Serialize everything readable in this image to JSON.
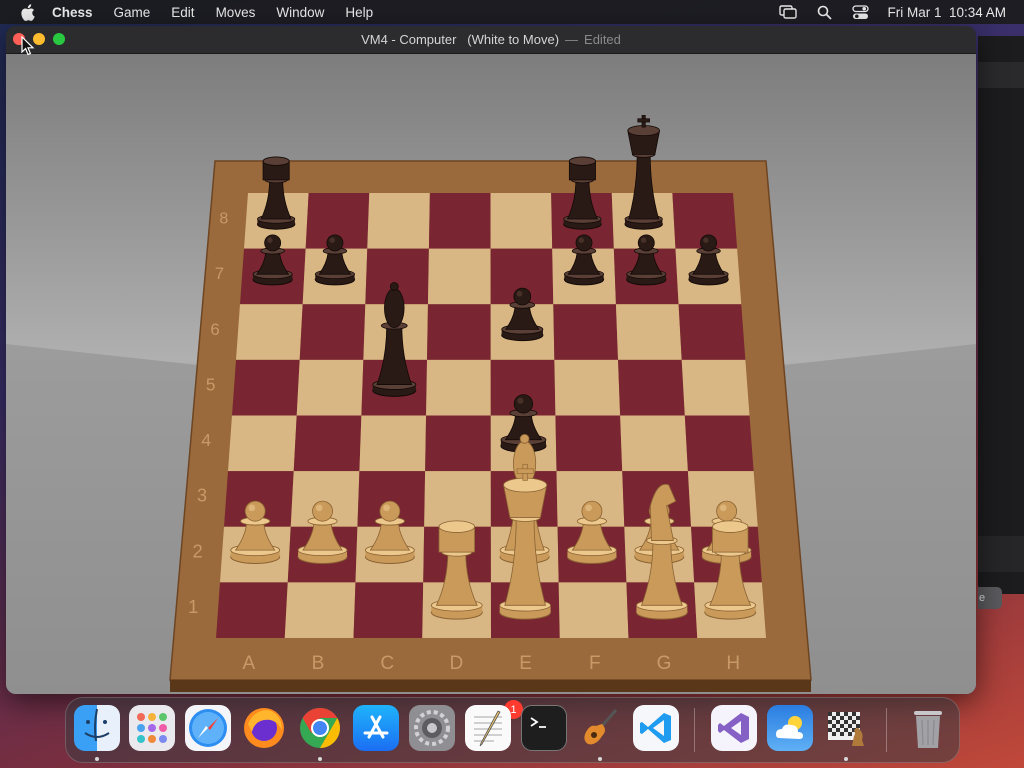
{
  "menubar": {
    "app_name": "Chess",
    "items": [
      "Game",
      "Edit",
      "Moves",
      "Window",
      "Help"
    ],
    "clock": "Fri Mar 1  10:34 AM",
    "icons": [
      "apple-icon",
      "screen-mirroring-icon",
      "search-icon",
      "control-center-icon"
    ]
  },
  "window": {
    "title": "VM4 - Computer   (White to Move)",
    "separator": "—",
    "edited": "Edited"
  },
  "board": {
    "files": [
      "A",
      "B",
      "C",
      "D",
      "E",
      "F",
      "G",
      "H"
    ],
    "ranks": [
      "8",
      "7",
      "6",
      "5",
      "4",
      "3",
      "2",
      "1"
    ],
    "light_square": "#d9b784",
    "dark_square": "#7a2632",
    "frame_color": "#9a6a3c",
    "pieces": [
      {
        "square": "a8",
        "piece": "rook",
        "color": "black"
      },
      {
        "square": "f8",
        "piece": "rook",
        "color": "black"
      },
      {
        "square": "g8",
        "piece": "king",
        "color": "black"
      },
      {
        "square": "a7",
        "piece": "pawn",
        "color": "black"
      },
      {
        "square": "b7",
        "piece": "pawn",
        "color": "black"
      },
      {
        "square": "f7",
        "piece": "pawn",
        "color": "black"
      },
      {
        "square": "g7",
        "piece": "pawn",
        "color": "black"
      },
      {
        "square": "h7",
        "piece": "pawn",
        "color": "black"
      },
      {
        "square": "e6",
        "piece": "pawn",
        "color": "black"
      },
      {
        "square": "c5",
        "piece": "bishop",
        "color": "black"
      },
      {
        "square": "e4",
        "piece": "pawn",
        "color": "black"
      },
      {
        "square": "a2",
        "piece": "pawn",
        "color": "white"
      },
      {
        "square": "b2",
        "piece": "pawn",
        "color": "white"
      },
      {
        "square": "c2",
        "piece": "pawn",
        "color": "white"
      },
      {
        "square": "e2",
        "piece": "bishop",
        "color": "white"
      },
      {
        "square": "f2",
        "piece": "pawn",
        "color": "white"
      },
      {
        "square": "g2",
        "piece": "pawn",
        "color": "white"
      },
      {
        "square": "h2",
        "piece": "pawn",
        "color": "white"
      },
      {
        "square": "d1",
        "piece": "rook",
        "color": "white"
      },
      {
        "square": "e1",
        "piece": "king",
        "color": "white"
      },
      {
        "square": "g1",
        "piece": "knight",
        "color": "white"
      },
      {
        "square": "h1",
        "piece": "rook",
        "color": "white"
      }
    ]
  },
  "background_window": {
    "button_label": "e"
  },
  "dock": {
    "apps": [
      {
        "name": "finder-icon"
      },
      {
        "name": "launchpad-icon"
      },
      {
        "name": "safari-icon"
      },
      {
        "name": "firefox-icon"
      },
      {
        "name": "chrome-icon"
      },
      {
        "name": "app-store-icon"
      },
      {
        "name": "system-settings-icon",
        "badge": "1"
      },
      {
        "name": "textedit-icon"
      },
      {
        "name": "terminal-icon"
      },
      {
        "name": "garageband-icon"
      },
      {
        "name": "vscode-icon"
      },
      {
        "name": "visual-studio-icon"
      },
      {
        "name": "weather-icon"
      },
      {
        "name": "chess-icon"
      },
      {
        "name": "trash-icon"
      }
    ]
  }
}
